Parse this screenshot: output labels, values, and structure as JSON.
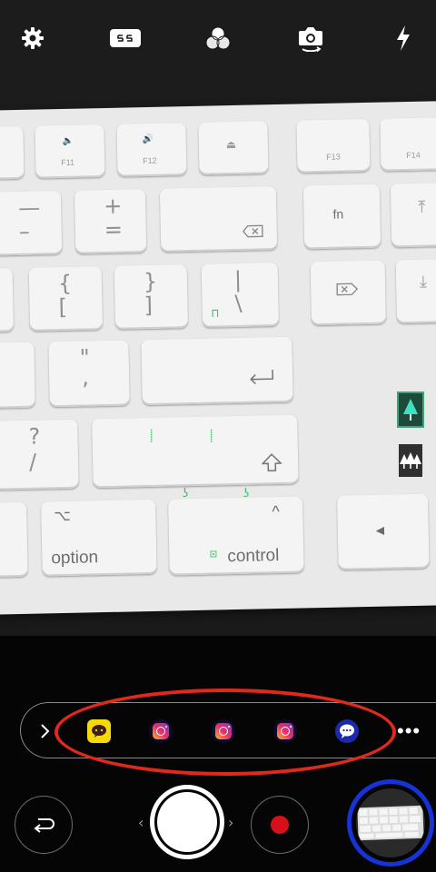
{
  "camera": {
    "toolbar": {
      "icons": [
        "gear-icon",
        "aspect-ratio-icon",
        "filter-icon",
        "switch-camera-icon",
        "flash-icon"
      ]
    },
    "keyboard_scene": {
      "keys": {
        "f11": "F11",
        "f12": "F12",
        "f13": "F13",
        "f14": "F14",
        "minus_top": "—",
        "minus_bottom": "–",
        "plus": "+",
        "equals": "=",
        "fn": "fn",
        "brace_open": "{",
        "bracket_open": "[",
        "brace_close": "}",
        "bracket_close": "]",
        "pipe": "|",
        "backslash": "\\",
        "quote": "\"",
        "apostrophe": ",",
        "question": "?",
        "slash": "/",
        "option": "option",
        "control": "control",
        "alt_symbol": "⌥",
        "caret": "^",
        "left_arrow": "◀"
      }
    },
    "side_controls": {
      "single_tree": "single-tree-icon",
      "multi_tree": "multi-tree-icon"
    },
    "app_tray": {
      "apps": [
        "kakaotalk-icon",
        "instagram-icon",
        "instagram-icon",
        "instagram-icon",
        "message-icon"
      ],
      "more_label": "•••"
    },
    "bottom": {
      "shutter_left_arrow": "‹",
      "shutter_right_arrow": "›"
    },
    "colors": {
      "highlight_red": "#e0291b",
      "highlight_blue": "#1533d6",
      "record": "#d8101a",
      "overlay_green": "#39c46a"
    }
  }
}
